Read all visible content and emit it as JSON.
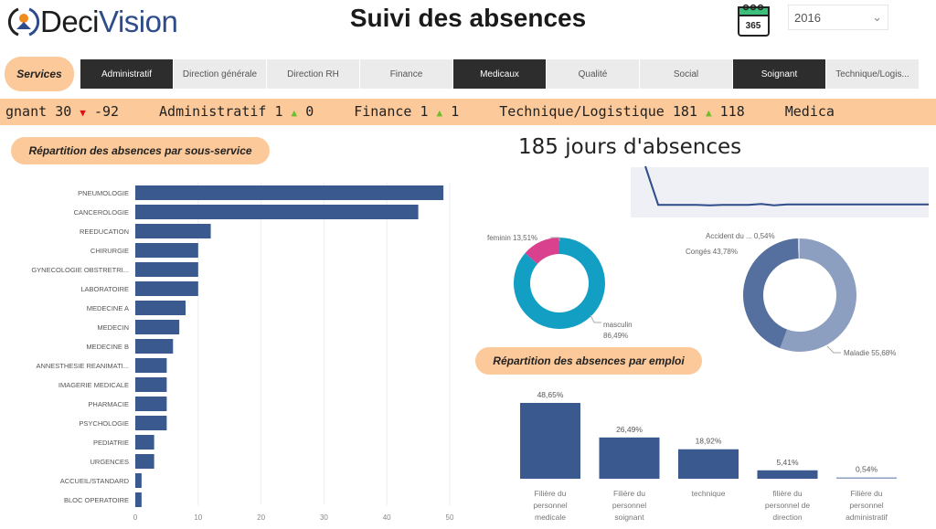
{
  "header": {
    "logo_text_a": "Deci",
    "logo_text_b": "Vision",
    "title": "Suivi des absences",
    "calendar_icon_text": "365",
    "year_selected": "2016"
  },
  "slicer": {
    "label": "Services",
    "items": [
      {
        "label": "Administratif",
        "selected": true
      },
      {
        "label": "Direction générale",
        "selected": false
      },
      {
        "label": "Direction RH",
        "selected": false
      },
      {
        "label": "Finance",
        "selected": false
      },
      {
        "label": "Medicaux",
        "selected": true
      },
      {
        "label": "Qualité",
        "selected": false
      },
      {
        "label": "Social",
        "selected": false
      },
      {
        "label": "Soignant",
        "selected": true
      },
      {
        "label": "Technique/Logis...",
        "selected": false
      }
    ]
  },
  "ticker": [
    {
      "name": "gnant",
      "value": "30",
      "trend": "down",
      "delta": "-92"
    },
    {
      "name": "Administratif",
      "value": "1",
      "trend": "up",
      "delta": "0"
    },
    {
      "name": "Finance",
      "value": "1",
      "trend": "up",
      "delta": "1"
    },
    {
      "name": "Technique/Logistique",
      "value": "181",
      "trend": "up",
      "delta": "118"
    },
    {
      "name": "Medica",
      "value": "",
      "trend": "",
      "delta": ""
    }
  ],
  "kpi": {
    "text": "185 jours d'absences"
  },
  "colors": {
    "accent": "#fbc99a",
    "bar": "#3a5a8f",
    "male": "#139fc4",
    "female": "#d9418f",
    "conges": "#556f9e",
    "maladie": "#8c9fc0",
    "accident": "#c9d2e2"
  },
  "chart_data": [
    {
      "type": "bar",
      "orientation": "horizontal",
      "title": "Répartition des absences par sous-service",
      "categories": [
        "PNEUMOLOGIE",
        "CANCEROLOGIE",
        "REEDUCATION",
        "CHIRURGIE",
        "GYNECOLOGIE OBSTRETRI...",
        "LABORATOIRE",
        "MEDECINE A",
        "MEDECIN",
        "MEDECINE B",
        "ANNESTHESIE REANIMATI...",
        "IMAGERIE MEDICALE",
        "PHARMACIE",
        "PSYCHOLOGIE",
        "PEDIATRIE",
        "URGENCES",
        "ACCUEIL/STANDARD",
        "BLOC OPERATOIRE"
      ],
      "values": [
        49,
        45,
        12,
        10,
        10,
        10,
        8,
        7,
        6,
        5,
        5,
        5,
        5,
        3,
        3,
        1,
        1
      ],
      "xlim": [
        0,
        50
      ],
      "xticks": [
        0,
        10,
        20,
        30,
        40,
        50
      ],
      "grid": true
    },
    {
      "type": "line",
      "title": "",
      "values": [
        100,
        12,
        12,
        12,
        12,
        11,
        12,
        12,
        12,
        14,
        11,
        13,
        13,
        13,
        13,
        13,
        13,
        13,
        13,
        13,
        13,
        13,
        13
      ],
      "axes": false
    },
    {
      "type": "pie",
      "donut": true,
      "slices": [
        {
          "label": "feminin",
          "value": 13.51,
          "text": "feminin 13,51%"
        },
        {
          "label": "masculin",
          "value": 86.49,
          "text1": "masculin",
          "text2": "86,49%"
        }
      ]
    },
    {
      "type": "pie",
      "donut": true,
      "slices": [
        {
          "label": "Maladie",
          "value": 55.68,
          "text": "Maladie 55,68%"
        },
        {
          "label": "Congés",
          "value": 43.78,
          "text": "Congés 43,78%"
        },
        {
          "label": "Accident du ...",
          "value": 0.54,
          "text": "Accident du ... 0,54%"
        }
      ]
    },
    {
      "type": "bar",
      "orientation": "vertical",
      "title": "Répartition des absences par emploi",
      "categories": [
        [
          "Filière du",
          "personnel",
          "medicale"
        ],
        [
          "Filière du",
          "personnel",
          "soignant"
        ],
        [
          "technique"
        ],
        [
          "filière du",
          "personnel de",
          "direction"
        ],
        [
          "Filière du",
          "personnel",
          "administratif"
        ]
      ],
      "values": [
        48.65,
        26.49,
        18.92,
        5.41,
        0.54
      ],
      "labels": [
        "48,65%",
        "26,49%",
        "18,92%",
        "5,41%",
        "0,54%"
      ]
    }
  ]
}
